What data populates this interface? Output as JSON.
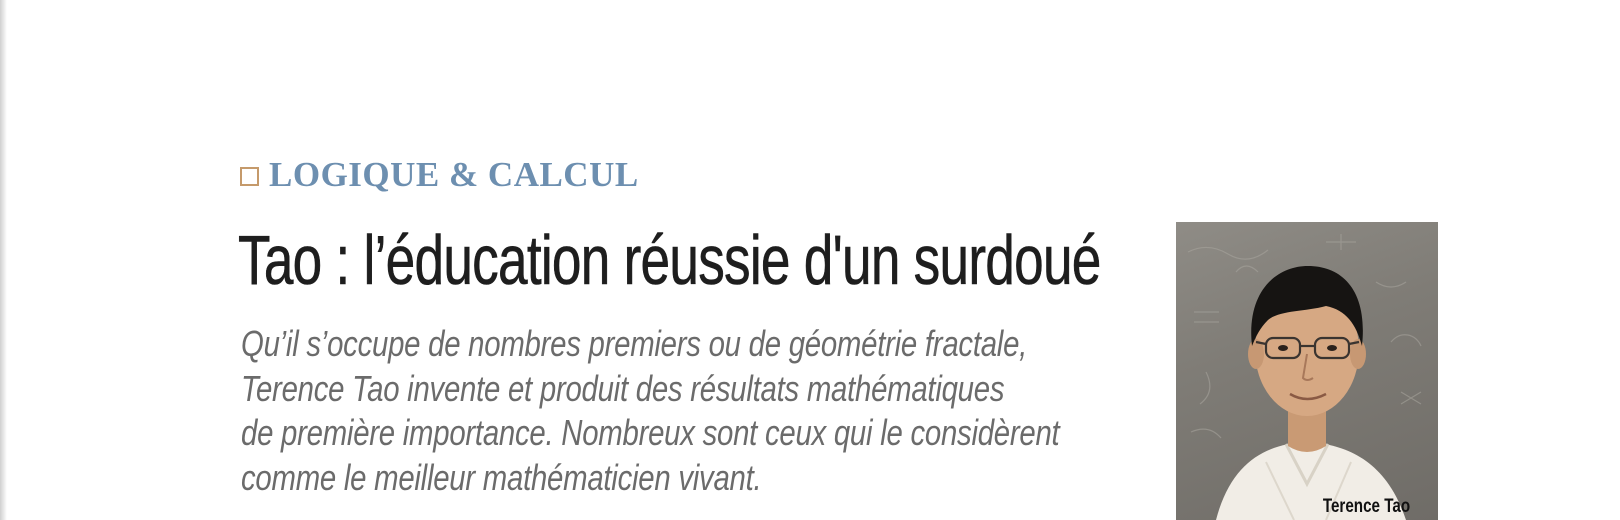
{
  "section": {
    "label": "LOGIQUE & CALCUL"
  },
  "article": {
    "title": "Tao : l’éducation réussie d'un surdoué",
    "lede_lines": [
      "Qu’il s’occupe de nombres premiers ou de géométrie fractale,",
      "Terence Tao invente et produit des résultats mathématiques",
      "de première importance. Nombreux sont ceux qui le considèrent",
      "comme le meilleur mathématicien vivant."
    ]
  },
  "photo": {
    "caption": "Terence Tao"
  },
  "colors": {
    "section_label": "#6d8fb0",
    "section_box": "#c59a6b",
    "title": "#1e1e1e",
    "lede": "#6b6b6b"
  }
}
